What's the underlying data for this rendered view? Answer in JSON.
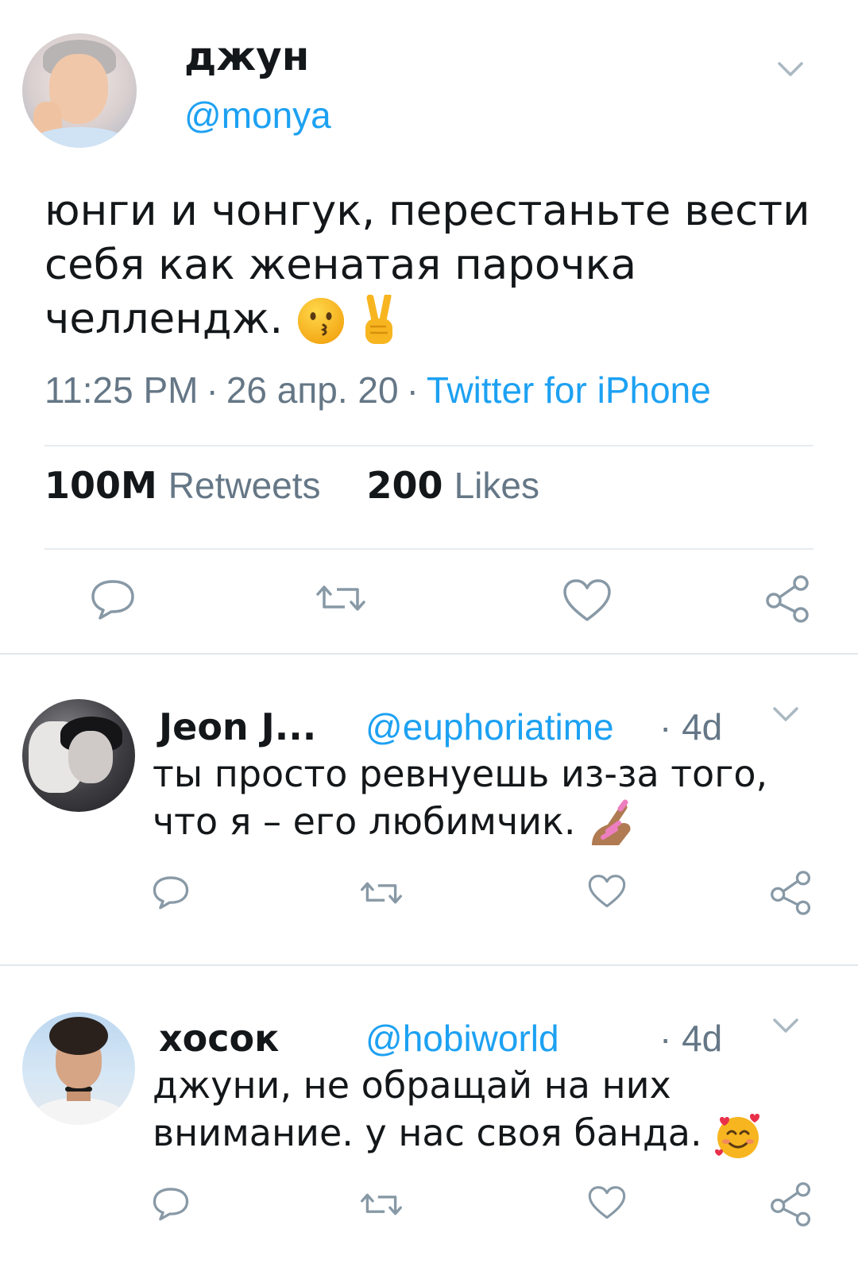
{
  "main_tweet": {
    "display_name": "джун",
    "handle": "@monya",
    "text": "юнги и чонгук, перестаньте вести себя как женатая парочка челлендж.",
    "emojis": [
      "kissing-face",
      "victory-hand"
    ],
    "time": "11:25 PM",
    "date": "26 апр. 20",
    "separator": "·",
    "source": "Twitter for iPhone",
    "retweets_count": "100M",
    "retweets_label": "Retweets",
    "likes_count": "200",
    "likes_label": "Likes"
  },
  "replies": [
    {
      "display_name": "Jeon J...",
      "handle": "@euphoriatime",
      "time": "· 4d",
      "text": "ты просто ревнуешь из-за того, что я – его любимчик.",
      "emoji": "nail-polish"
    },
    {
      "display_name": "хосок",
      "handle": "@hobiworld",
      "time": "· 4d",
      "text": "джуни, не обращай на них внимание. у нас своя банда.",
      "emoji": "smiling-face-with-hearts"
    }
  ],
  "icons": {
    "reply": "reply-icon",
    "retweet": "retweet-icon",
    "like": "heart-icon",
    "share": "share-icon",
    "more": "chevron-down-icon"
  },
  "colors": {
    "accent": "#1da1f2",
    "secondary_text": "#657786",
    "primary_text": "#14171a",
    "divider": "#e1e8ed"
  }
}
